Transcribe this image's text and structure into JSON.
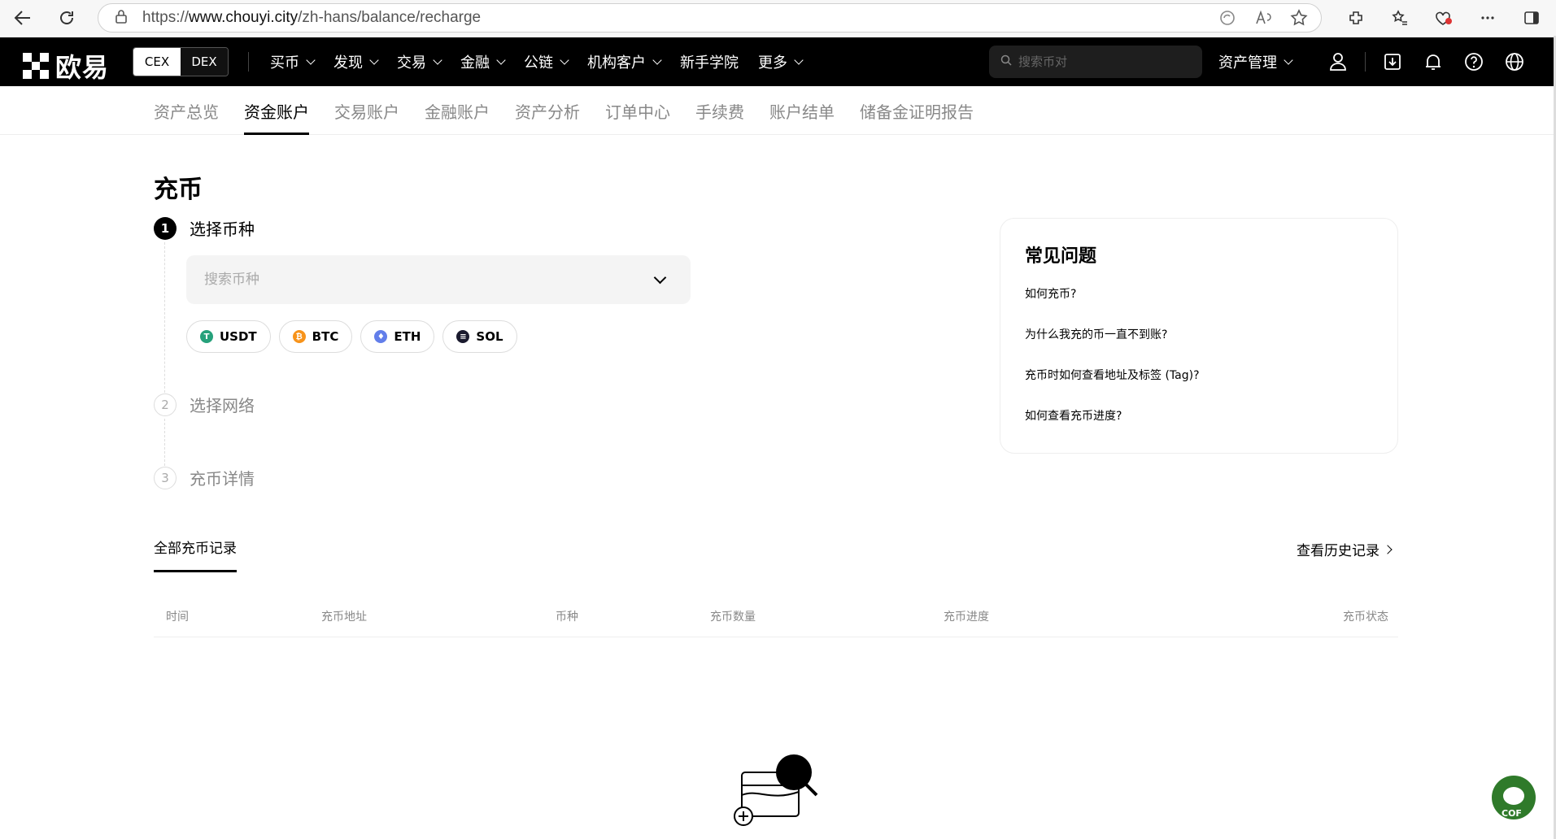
{
  "browser": {
    "url_prefix": "https://",
    "url_host": "www.chouyi.city",
    "url_path": "/zh-hans/balance/recharge"
  },
  "topnav": {
    "logo_text": "欧易",
    "segment": [
      "CEX",
      "DEX"
    ],
    "items": [
      {
        "label": "买币",
        "dropdown": true
      },
      {
        "label": "发现",
        "dropdown": true
      },
      {
        "label": "交易",
        "dropdown": true
      },
      {
        "label": "金融",
        "dropdown": true
      },
      {
        "label": "公链",
        "dropdown": true
      },
      {
        "label": "机构客户",
        "dropdown": true
      },
      {
        "label": "新手学院",
        "dropdown": false
      },
      {
        "label": "更多",
        "dropdown": true
      }
    ],
    "search_placeholder": "搜索币对",
    "asset_management": "资产管理",
    "icons": [
      "user-icon",
      "download-icon",
      "bell-icon",
      "help-icon",
      "globe-icon"
    ]
  },
  "subnav": {
    "items": [
      "资产总览",
      "资金账户",
      "交易账户",
      "金融账户",
      "资产分析",
      "订单中心",
      "手续费",
      "账户结单",
      "储备金证明报告"
    ],
    "active_index": 1
  },
  "main": {
    "title": "充币",
    "steps": [
      {
        "num": "1",
        "label": "选择币种",
        "active": true
      },
      {
        "num": "2",
        "label": "选择网络",
        "active": false
      },
      {
        "num": "3",
        "label": "充币详情",
        "active": false
      }
    ],
    "coin_search_placeholder": "搜索币种",
    "quick_coins": [
      {
        "symbol": "USDT",
        "color": "#26a17b",
        "glyph": "T"
      },
      {
        "symbol": "BTC",
        "color": "#f7931a",
        "glyph": "₿"
      },
      {
        "symbol": "ETH",
        "color": "#627eea",
        "glyph": "♦"
      },
      {
        "symbol": "SOL",
        "color": "#1a1a2e",
        "glyph": "≡"
      }
    ]
  },
  "faq": {
    "title": "常见问题",
    "links": [
      "如何充币?",
      "为什么我充的币一直不到账?",
      "充币时如何查看地址及标签 (Tag)?",
      "如何查看充币进度?"
    ]
  },
  "records": {
    "tab": "全部充币记录",
    "history_link": "查看历史记录",
    "columns": [
      "时间",
      "充币地址",
      "币种",
      "充币数量",
      "充币进度",
      "充币状态"
    ]
  },
  "badge": {
    "text": "COF"
  }
}
